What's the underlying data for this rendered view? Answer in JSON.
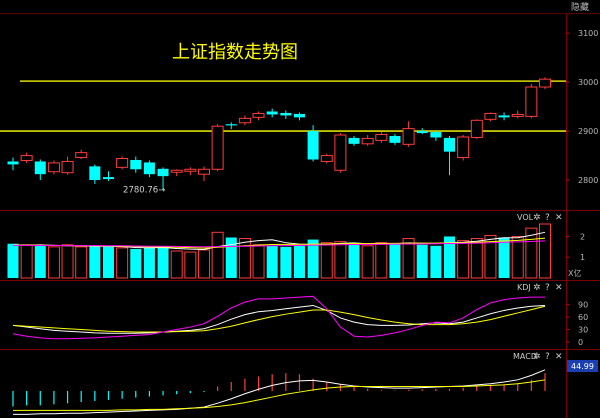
{
  "header": {
    "hide_label": "隐藏"
  },
  "chart_data": {
    "type": "candlestick",
    "title": "上证指数走势图",
    "price_axis": {
      "ticks": [
        3100,
        3000,
        2900,
        2800
      ],
      "ylim": [
        2745,
        3135
      ]
    },
    "reference_lines": [
      3002,
      2900
    ],
    "annotations": [
      {
        "text": "2780.76",
        "candle_index": 11
      }
    ],
    "candles": [
      {
        "o": 2838,
        "c": 2832,
        "h": 2846,
        "l": 2820
      },
      {
        "o": 2840,
        "c": 2850,
        "h": 2856,
        "l": 2835
      },
      {
        "o": 2838,
        "c": 2812,
        "h": 2842,
        "l": 2800
      },
      {
        "o": 2817,
        "c": 2835,
        "h": 2840,
        "l": 2812
      },
      {
        "o": 2815,
        "c": 2838,
        "h": 2848,
        "l": 2811
      },
      {
        "o": 2846,
        "c": 2856,
        "h": 2862,
        "l": 2843
      },
      {
        "o": 2828,
        "c": 2800,
        "h": 2832,
        "l": 2792
      },
      {
        "o": 2806,
        "c": 2802,
        "h": 2818,
        "l": 2798
      },
      {
        "o": 2826,
        "c": 2844,
        "h": 2848,
        "l": 2822
      },
      {
        "o": 2841,
        "c": 2822,
        "h": 2848,
        "l": 2815
      },
      {
        "o": 2836,
        "c": 2812,
        "h": 2840,
        "l": 2806
      },
      {
        "o": 2823,
        "c": 2808,
        "h": 2826,
        "l": 2781
      },
      {
        "o": 2816,
        "c": 2820,
        "h": 2822,
        "l": 2808
      },
      {
        "o": 2818,
        "c": 2822,
        "h": 2826,
        "l": 2810
      },
      {
        "o": 2812,
        "c": 2822,
        "h": 2828,
        "l": 2798
      },
      {
        "o": 2822,
        "c": 2910,
        "h": 2914,
        "l": 2818
      },
      {
        "o": 2914,
        "c": 2912,
        "h": 2918,
        "l": 2904
      },
      {
        "o": 2917,
        "c": 2926,
        "h": 2932,
        "l": 2912
      },
      {
        "o": 2928,
        "c": 2936,
        "h": 2940,
        "l": 2922
      },
      {
        "o": 2940,
        "c": 2934,
        "h": 2946,
        "l": 2928
      },
      {
        "o": 2937,
        "c": 2932,
        "h": 2942,
        "l": 2925
      },
      {
        "o": 2935,
        "c": 2928,
        "h": 2938,
        "l": 2922
      },
      {
        "o": 2900,
        "c": 2842,
        "h": 2912,
        "l": 2838
      },
      {
        "o": 2838,
        "c": 2850,
        "h": 2854,
        "l": 2834
      },
      {
        "o": 2820,
        "c": 2892,
        "h": 2896,
        "l": 2815
      },
      {
        "o": 2886,
        "c": 2874,
        "h": 2890,
        "l": 2870
      },
      {
        "o": 2874,
        "c": 2885,
        "h": 2892,
        "l": 2870
      },
      {
        "o": 2881,
        "c": 2893,
        "h": 2898,
        "l": 2876
      },
      {
        "o": 2890,
        "c": 2876,
        "h": 2894,
        "l": 2872
      },
      {
        "o": 2873,
        "c": 2905,
        "h": 2920,
        "l": 2868
      },
      {
        "o": 2900,
        "c": 2896,
        "h": 2906,
        "l": 2894
      },
      {
        "o": 2898,
        "c": 2887,
        "h": 2902,
        "l": 2880
      },
      {
        "o": 2886,
        "c": 2858,
        "h": 2890,
        "l": 2810
      },
      {
        "o": 2846,
        "c": 2888,
        "h": 2892,
        "l": 2840
      },
      {
        "o": 2887,
        "c": 2922,
        "h": 2924,
        "l": 2884
      },
      {
        "o": 2924,
        "c": 2936,
        "h": 2938,
        "l": 2920
      },
      {
        "o": 2932,
        "c": 2928,
        "h": 2938,
        "l": 2922
      },
      {
        "o": 2930,
        "c": 2934,
        "h": 2942,
        "l": 2926
      },
      {
        "o": 2930,
        "c": 2990,
        "h": 2996,
        "l": 2926
      },
      {
        "o": 2990,
        "c": 3006,
        "h": 3010,
        "l": 2986
      }
    ],
    "volume_panel": {
      "title": "VOL",
      "unit_label": "亿",
      "ticks": [
        2,
        1
      ],
      "ylim": [
        0,
        2.6
      ],
      "volumes": [
        1.65,
        1.6,
        1.55,
        1.5,
        1.6,
        1.5,
        1.55,
        1.55,
        1.45,
        1.4,
        1.45,
        1.5,
        1.3,
        1.25,
        1.35,
        2.2,
        1.95,
        1.9,
        1.6,
        1.55,
        1.5,
        1.55,
        1.85,
        1.7,
        1.75,
        1.6,
        1.55,
        1.7,
        1.65,
        1.9,
        1.6,
        1.55,
        2.0,
        1.8,
        1.9,
        2.05,
        1.95,
        2.0,
        2.4,
        2.6
      ],
      "ma_lines": [
        {
          "color": "#ffffff",
          "values": [
            1.6,
            1.58,
            1.6,
            1.57,
            1.55,
            1.55,
            1.53,
            1.53,
            1.51,
            1.47,
            1.45,
            1.47,
            1.42,
            1.39,
            1.37,
            1.51,
            1.61,
            1.72,
            1.8,
            1.84,
            1.7,
            1.63,
            1.61,
            1.63,
            1.67,
            1.69,
            1.65,
            1.66,
            1.65,
            1.69,
            1.67,
            1.66,
            1.7,
            1.72,
            1.77,
            1.86,
            1.94,
            1.94,
            2.06,
            2.2
          ]
        },
        {
          "color": "#ffff00",
          "values": [
            1.58,
            1.58,
            1.58,
            1.57,
            1.56,
            1.55,
            1.55,
            1.54,
            1.53,
            1.52,
            1.5,
            1.5,
            1.48,
            1.46,
            1.44,
            1.48,
            1.51,
            1.55,
            1.58,
            1.61,
            1.62,
            1.62,
            1.63,
            1.64,
            1.65,
            1.66,
            1.66,
            1.67,
            1.67,
            1.68,
            1.68,
            1.68,
            1.69,
            1.7,
            1.72,
            1.75,
            1.78,
            1.81,
            1.86,
            1.92
          ]
        },
        {
          "color": "#ff00ff",
          "values": [
            1.57,
            1.57,
            1.57,
            1.57,
            1.56,
            1.56,
            1.56,
            1.55,
            1.55,
            1.54,
            1.53,
            1.53,
            1.52,
            1.51,
            1.5,
            1.51,
            1.52,
            1.53,
            1.54,
            1.55,
            1.56,
            1.57,
            1.58,
            1.59,
            1.6,
            1.61,
            1.62,
            1.62,
            1.63,
            1.64,
            1.64,
            1.65,
            1.66,
            1.67,
            1.68,
            1.7,
            1.72,
            1.74,
            1.76,
            1.79
          ]
        }
      ]
    },
    "kdj_panel": {
      "title": "KDJ",
      "ticks": [
        90,
        60,
        30,
        0
      ],
      "ylim": [
        -12,
        118
      ],
      "lines": [
        {
          "name": "K",
          "color": "#ffffff",
          "values": [
            40,
            36,
            32,
            28,
            26,
            24,
            22,
            21,
            21,
            21,
            22,
            24,
            26,
            28,
            32,
            42,
            55,
            66,
            73,
            76,
            80,
            84,
            88,
            76,
            58,
            48,
            42,
            40,
            40,
            41,
            44,
            46,
            44,
            48,
            58,
            68,
            76,
            82,
            86,
            88
          ]
        },
        {
          "name": "D",
          "color": "#ffff00",
          "values": [
            40,
            38,
            36,
            34,
            32,
            30,
            28,
            26,
            25,
            24,
            24,
            24,
            25,
            26,
            27,
            32,
            38,
            46,
            54,
            61,
            67,
            72,
            77,
            77,
            72,
            66,
            59,
            53,
            48,
            44,
            42,
            42,
            42,
            44,
            48,
            54,
            62,
            70,
            78,
            86
          ]
        },
        {
          "name": "J",
          "color": "#ff00ff",
          "values": [
            20,
            14,
            10,
            8,
            8,
            9,
            10,
            12,
            14,
            16,
            18,
            24,
            30,
            36,
            44,
            62,
            82,
            96,
            104,
            104,
            106,
            108,
            110,
            80,
            36,
            14,
            12,
            16,
            22,
            30,
            40,
            48,
            46,
            58,
            78,
            94,
            102,
            106,
            108,
            108
          ]
        }
      ]
    },
    "macd_panel": {
      "title": "MACD",
      "value_label": "44.99",
      "ylim": [
        -45,
        52
      ],
      "bars": [
        -28,
        -26,
        -26,
        -24,
        -22,
        -20,
        -18,
        -16,
        -14,
        -12,
        -10,
        -8,
        -6,
        -4,
        -2,
        8,
        16,
        22,
        26,
        30,
        32,
        30,
        22,
        16,
        12,
        8,
        4,
        2,
        1,
        2,
        3,
        4,
        4,
        6,
        8,
        10,
        12,
        14,
        20,
        32
      ],
      "lines": [
        {
          "name": "DIF",
          "color": "#ffffff",
          "values": [
            -42,
            -42,
            -41,
            -41,
            -40,
            -40,
            -39,
            -38,
            -37,
            -36,
            -35,
            -34,
            -33,
            -31,
            -29,
            -22,
            -14,
            -5,
            3,
            10,
            15,
            18,
            19,
            16,
            12,
            9,
            7,
            6,
            5,
            5,
            6,
            7,
            8,
            9,
            11,
            13,
            16,
            20,
            28,
            38
          ]
        },
        {
          "name": "DEA",
          "color": "#ffff00",
          "values": [
            -35,
            -35,
            -35,
            -35,
            -35,
            -35,
            -35,
            -35,
            -34,
            -34,
            -33,
            -33,
            -32,
            -31,
            -30,
            -28,
            -25,
            -21,
            -16,
            -11,
            -6,
            -2,
            2,
            5,
            7,
            8,
            8,
            8,
            8,
            8,
            8,
            8,
            8,
            8,
            9,
            10,
            11,
            13,
            16,
            20
          ]
        }
      ]
    }
  }
}
